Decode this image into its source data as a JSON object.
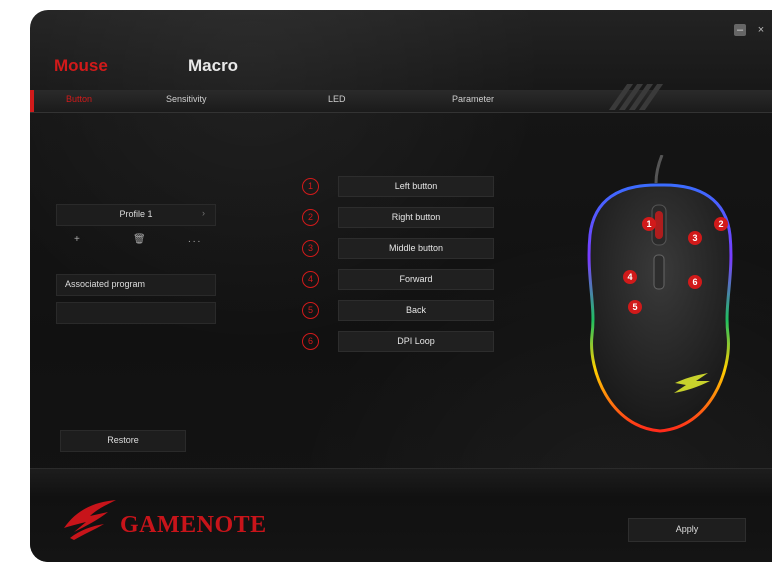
{
  "window": {
    "minimize_glyph": "–",
    "close_glyph": "×"
  },
  "tabs": {
    "mouse": "Mouse",
    "macro": "Macro"
  },
  "subtabs": {
    "button": "Button",
    "sensitivity": "Sensitivity",
    "led": "LED",
    "parameter": "Parameter"
  },
  "sidebar": {
    "profile": "Profile 1",
    "add": "+",
    "delete": "🗑",
    "more": "...",
    "associated_program": "Associated program",
    "associated_value": "",
    "restore": "Restore"
  },
  "button_map": [
    {
      "num": "1",
      "label": "Left button"
    },
    {
      "num": "2",
      "label": "Right button"
    },
    {
      "num": "3",
      "label": "Middle button"
    },
    {
      "num": "4",
      "label": "Forward"
    },
    {
      "num": "5",
      "label": "Back"
    },
    {
      "num": "6",
      "label": "DPI Loop"
    }
  ],
  "mouse_badges": [
    "1",
    "2",
    "3",
    "4",
    "5",
    "6"
  ],
  "footer": {
    "brand": "GAMENOTE",
    "apply": "Apply"
  },
  "colors": {
    "accent": "#d11a1a",
    "background": "#141414"
  }
}
